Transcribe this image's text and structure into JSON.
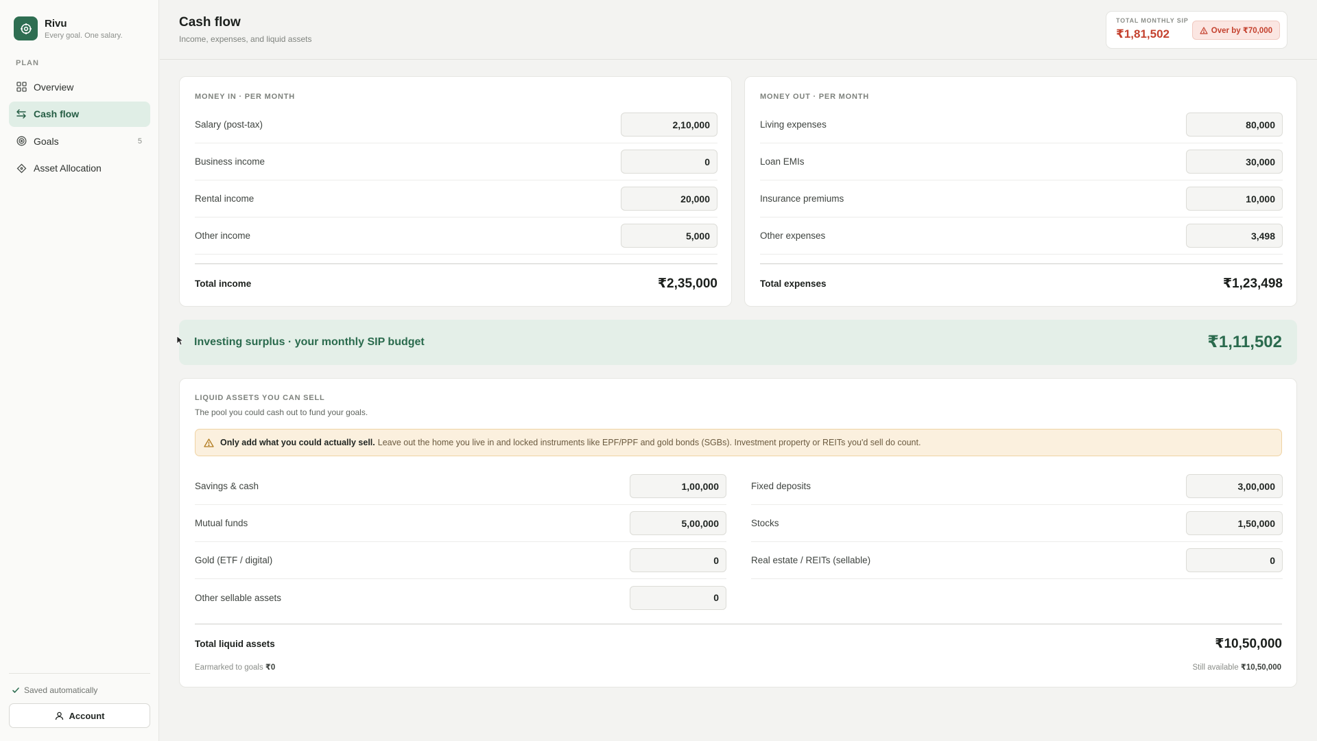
{
  "brand": {
    "name": "Rivu",
    "tagline": "Every goal. One salary."
  },
  "sidebar": {
    "section": "PLAN",
    "items": [
      {
        "label": "Overview",
        "icon": "grid-icon",
        "active": false
      },
      {
        "label": "Cash flow",
        "icon": "arrows-swap-icon",
        "active": true
      },
      {
        "label": "Goals",
        "icon": "target-icon",
        "active": false,
        "count": "5"
      },
      {
        "label": "Asset Allocation",
        "icon": "diamond-icon",
        "active": false
      }
    ],
    "saved": "Saved automatically",
    "account": "Account"
  },
  "header": {
    "title": "Cash flow",
    "subtitle": "Income, expenses, and liquid assets",
    "sip_label": "TOTAL MONTHLY SIP",
    "sip_value": "₹1,81,502",
    "over_badge": "Over by ₹70,000"
  },
  "money_in": {
    "label": "MONEY IN · PER MONTH",
    "rows": [
      {
        "label": "Salary (post-tax)",
        "value": "2,10,000"
      },
      {
        "label": "Business income",
        "value": "0"
      },
      {
        "label": "Rental income",
        "value": "20,000"
      },
      {
        "label": "Other income",
        "value": "5,000"
      }
    ],
    "total_label": "Total income",
    "total_value": "₹2,35,000"
  },
  "money_out": {
    "label": "MONEY OUT · PER MONTH",
    "rows": [
      {
        "label": "Living expenses",
        "value": "80,000"
      },
      {
        "label": "Loan EMIs",
        "value": "30,000"
      },
      {
        "label": "Insurance premiums",
        "value": "10,000"
      },
      {
        "label": "Other expenses",
        "value": "3,498"
      }
    ],
    "total_label": "Total expenses",
    "total_value": "₹1,23,498"
  },
  "surplus": {
    "label": "Investing surplus · your monthly SIP budget",
    "value": "₹1,11,502"
  },
  "liquid": {
    "label": "LIQUID ASSETS YOU CAN SELL",
    "subtitle": "The pool you could cash out to fund your goals.",
    "warning_bold": "Only add what you could actually sell.",
    "warning_text": "Leave out the home you live in and locked instruments like EPF/PPF and gold bonds (SGBs). Investment property or REITs you'd sell do count.",
    "left_rows": [
      {
        "label": "Savings & cash",
        "value": "1,00,000"
      },
      {
        "label": "Mutual funds",
        "value": "5,00,000"
      },
      {
        "label": "Gold (ETF / digital)",
        "value": "0"
      },
      {
        "label": "Other sellable assets",
        "value": "0"
      }
    ],
    "right_rows": [
      {
        "label": "Fixed deposits",
        "value": "3,00,000"
      },
      {
        "label": "Stocks",
        "value": "1,50,000"
      },
      {
        "label": "Real estate / REITs (sellable)",
        "value": "0"
      }
    ],
    "total_label": "Total liquid assets",
    "total_value": "₹10,50,000",
    "earmarked_label": "Earmarked to goals",
    "earmarked_value": "₹0",
    "available_label": "Still available",
    "available_value": "₹10,50,000"
  },
  "colors": {
    "accent": "#2e6e52",
    "danger": "#c4412e",
    "surplus_bg": "#e4efe8",
    "warning_bg": "#fbf0de"
  }
}
